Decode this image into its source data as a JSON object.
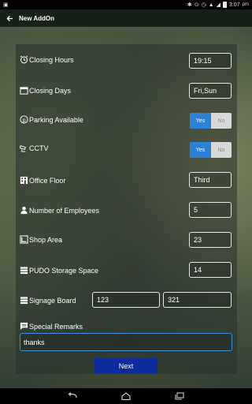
{
  "status_bar": {
    "time": "3:07",
    "ampm": "pm"
  },
  "header": {
    "title": "New AddOn"
  },
  "form": {
    "closing_hours": {
      "label": "Closing Hours",
      "value": "19:15"
    },
    "closing_days": {
      "label": "Closing Days",
      "value": "Fri,Sun"
    },
    "parking": {
      "label": "Parking Available",
      "yes": "Yes",
      "no": "No",
      "selected": "Yes"
    },
    "cctv": {
      "label": "CCTV",
      "yes": "Yes",
      "no": "No",
      "selected": "Yes"
    },
    "office_floor": {
      "label": "Office Floor",
      "value": "Third"
    },
    "employees": {
      "label": "Number of Employees",
      "value": "5"
    },
    "shop_area": {
      "label": "Shop Area",
      "value": "23"
    },
    "pudo": {
      "label": "PUDO Storage Space",
      "value": "14"
    },
    "signage": {
      "label": "Signage Board",
      "value1": "123",
      "value2": "321"
    },
    "remarks": {
      "label": "Special Remarks",
      "value": "thanks"
    }
  },
  "next_label": "Next",
  "colors": {
    "toggle_active": "#2e82d6",
    "next_button": "#0d2c9c",
    "focus_border": "#3a8fd9"
  }
}
